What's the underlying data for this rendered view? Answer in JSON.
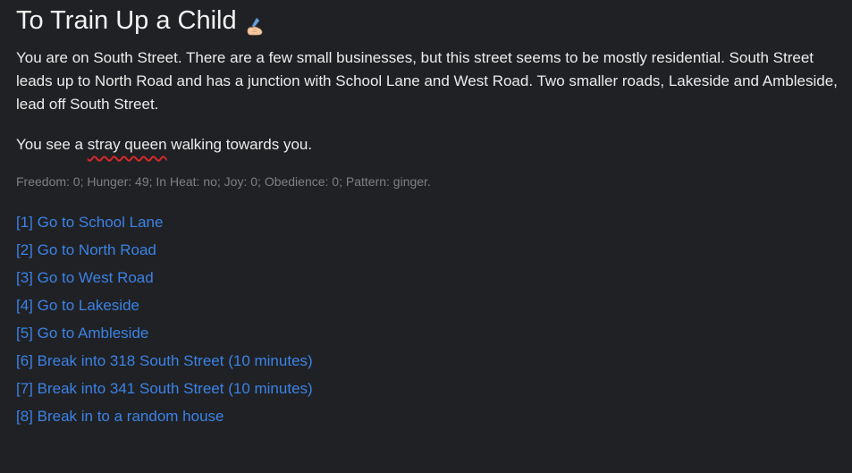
{
  "title": "To Train Up a Child",
  "title_icon": "writing-hand-icon",
  "description": "You are on South Street. There are a few small businesses, but this street seems to be mostly residential. South Street leads up to North Road and has a junction with School Lane and West Road. Two smaller roads, Lakeside and Ambleside, lead off South Street.",
  "encounter": {
    "prefix": "You see a ",
    "subject": "stray queen",
    "suffix": " walking towards you."
  },
  "stats": "Freedom: 0; Hunger: 49; In Heat: no; Joy: 0; Obedience: 0; Pattern: ginger.",
  "choices": [
    "[1] Go to School Lane",
    "[2] Go to North Road",
    "[3] Go to West Road",
    "[4] Go to Lakeside",
    "[5] Go to Ambleside",
    "[6] Break into 318 South Street (10 minutes)",
    "[7] Break into 341 South Street (10 minutes)",
    "[8] Break in to a random house"
  ],
  "colors": {
    "background": "#202124",
    "text": "#ececec",
    "muted": "#7d7f84",
    "link": "#3b82e6",
    "spellcheck_underline": "#d42a2a"
  }
}
